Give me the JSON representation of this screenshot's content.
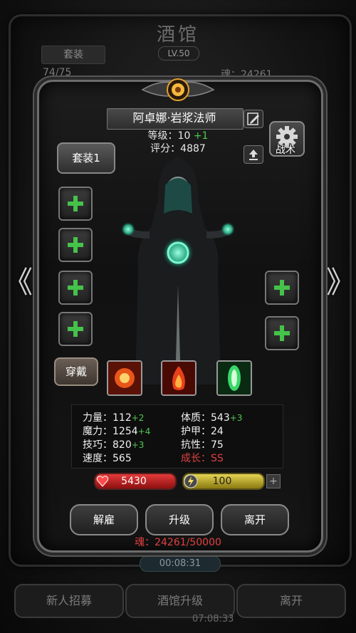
{
  "background": {
    "title": "酒馆",
    "set_label": "套装",
    "level": "LV.50",
    "count": "74/75",
    "soul": "魂：24261",
    "timer1": "00:08:31",
    "timer2": "07:08:33",
    "buttons": [
      "新人招募",
      "酒馆升级",
      "离开"
    ]
  },
  "nav": {
    "prev": "《",
    "next": "》"
  },
  "hero": {
    "name": "阿卓娜·岩浆法师",
    "level_label": "等级：10",
    "level_bonus": "+1",
    "score_label": "评分：4887"
  },
  "buttons": {
    "suit": "套装1",
    "tactic": "战术",
    "equip": "穿戴",
    "dismiss": "解雇",
    "upgrade": "升级",
    "leave": "离开"
  },
  "stats": {
    "str_label": "力量：112",
    "str_bonus": "+2",
    "int_label": "魔力：1254",
    "int_bonus": "+4",
    "dex_label": "技巧：820",
    "dex_bonus": "+3",
    "spd_label": "速度：565",
    "con_label": "体质：543",
    "con_bonus": "+3",
    "arm_label": "护甲：24",
    "res_label": "抗性：75",
    "growth_label": "成长：SS"
  },
  "bars": {
    "hp": "5430",
    "energy": "100",
    "plus": "+"
  },
  "soul_total": "魂：24261/50000",
  "colors": {
    "accent_green": "#4ec94e",
    "accent_red": "#e24040",
    "hp": "#e53a3a",
    "energy": "#e6d452"
  },
  "icons": [
    "weapon-slot-icon",
    "armor-slot-icon",
    "ring-slot-icon",
    "amulet-slot-icon",
    "gear-icon",
    "edit-icon",
    "upload-icon",
    "heart-icon",
    "lightning-icon"
  ]
}
